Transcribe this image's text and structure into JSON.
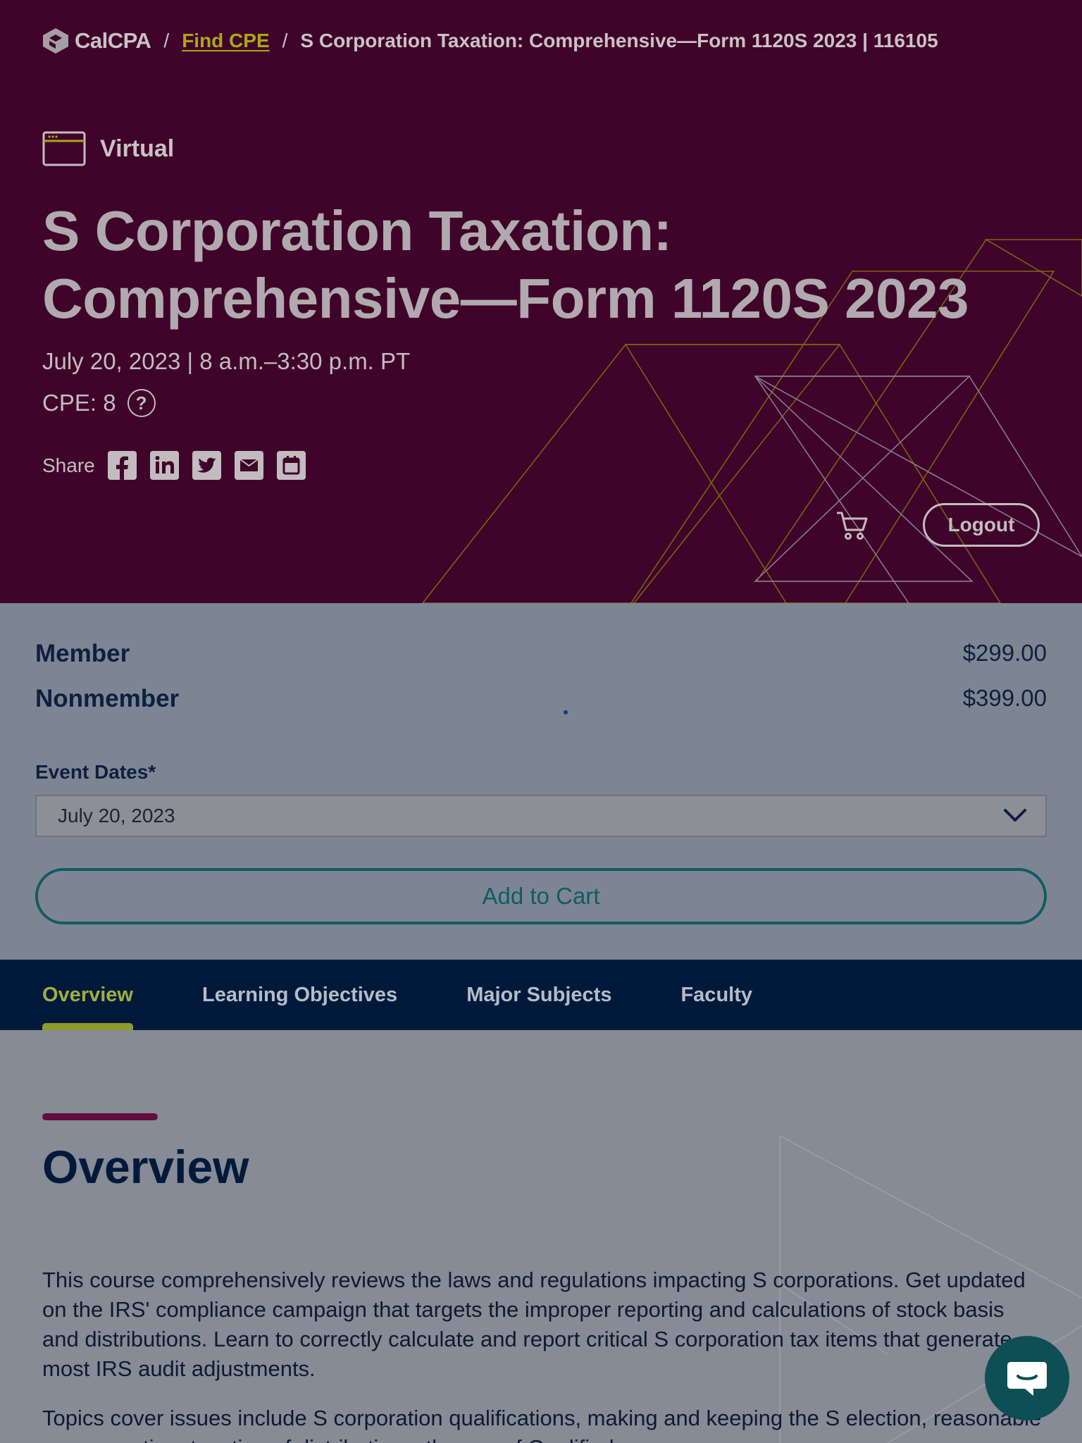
{
  "breadcrumb": {
    "logo_text": "CalCPA",
    "separator": "/",
    "find_cpe": "Find CPE",
    "current": "S Corporation Taxation: Comprehensive—Form 1120S 2023 | 116105"
  },
  "hero": {
    "format": "Virtual",
    "title_line1": "S Corporation Taxation:",
    "title_line2": "Comprehensive—Form 1120S 2023",
    "date_time": "July 20, 2023 | 8 a.m.–3:30 p.m. PT",
    "cpe": "CPE: 8",
    "help_glyph": "?",
    "share_label": "Share",
    "share_icons": [
      "facebook-icon",
      "linkedin-icon",
      "twitter-icon",
      "email-icon",
      "calendar-icon"
    ],
    "logout": "Logout"
  },
  "pricing": {
    "member_label": "Member",
    "member_price": "$299.00",
    "nonmember_label": "Nonmember",
    "nonmember_price": "$399.00"
  },
  "event_dates": {
    "label": "Event Dates*",
    "selected": "July 20, 2023"
  },
  "add_to_cart": "Add to Cart",
  "tabs": [
    {
      "label": "Overview",
      "active": true
    },
    {
      "label": "Learning Objectives",
      "active": false
    },
    {
      "label": "Major Subjects",
      "active": false
    },
    {
      "label": "Faculty",
      "active": false
    }
  ],
  "overview": {
    "heading": "Overview",
    "paragraph1": "This course comprehensively reviews the laws and regulations impacting S corporations. Get updated on the IRS' compliance campaign that targets the improper reporting and calculations of stock basis and distributions. Learn to correctly calculate and report critical S corporation tax items that generate most IRS audit adjustments.",
    "paragraph2": "Topics cover issues include S corporation qualifications, making and keeping the S election, reasonable compensation, taxation of distributions, the use of Qualified"
  },
  "colors": {
    "hero_bg": "#40042a",
    "accent_gold": "#a9a818",
    "navy": "#011a3c",
    "teal": "#0f5d62",
    "overlay_panel": "#7e8592"
  }
}
